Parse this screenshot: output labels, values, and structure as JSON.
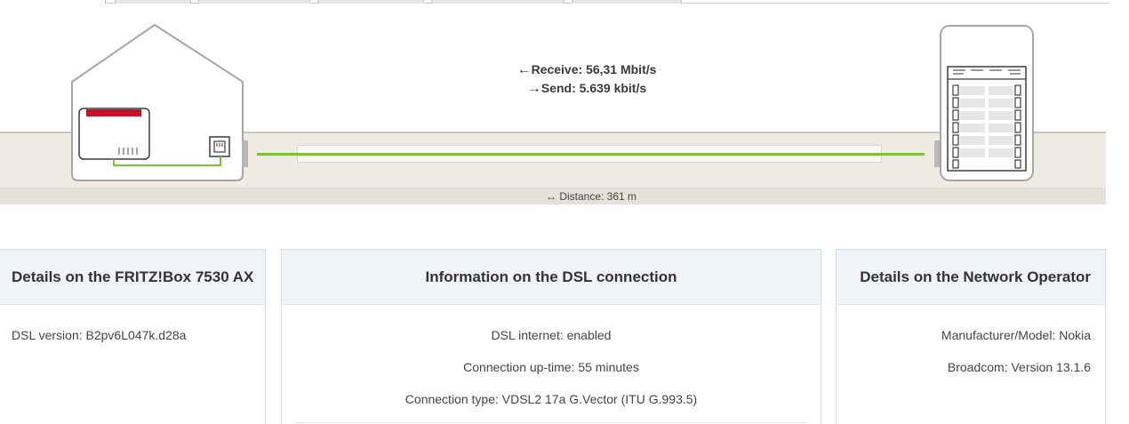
{
  "connection": {
    "receive_label": "Receive: 56,31 Mbit/s",
    "send_label": "Send: 5.639 kbit/s",
    "distance_label": "Distance: 361 m"
  },
  "icons": {
    "receive_arrow": "←",
    "send_arrow": "→",
    "distance_arrow": "↔"
  },
  "colors": {
    "dsl_line": "#7bbf3c",
    "fritzbox_red": "#c8102e",
    "card_header_bg": "#f0f3f8"
  },
  "cards": {
    "fritzbox": {
      "title": "Details on the FRITZ!Box 7530 AX",
      "rows": [
        "DSL version: B2pv6L047k.d28a"
      ]
    },
    "dsl": {
      "title": "Information on the DSL connection",
      "rows": [
        "DSL internet: enabled",
        "Connection up-time: 55 minutes",
        "Connection type: VDSL2 17a G.Vector (ITU G.993.5)"
      ]
    },
    "operator": {
      "title": "Details on the Network Operator",
      "rows": [
        "Manufacturer/Model: Nokia",
        "Broadcom: Version 13.1.6"
      ]
    }
  }
}
